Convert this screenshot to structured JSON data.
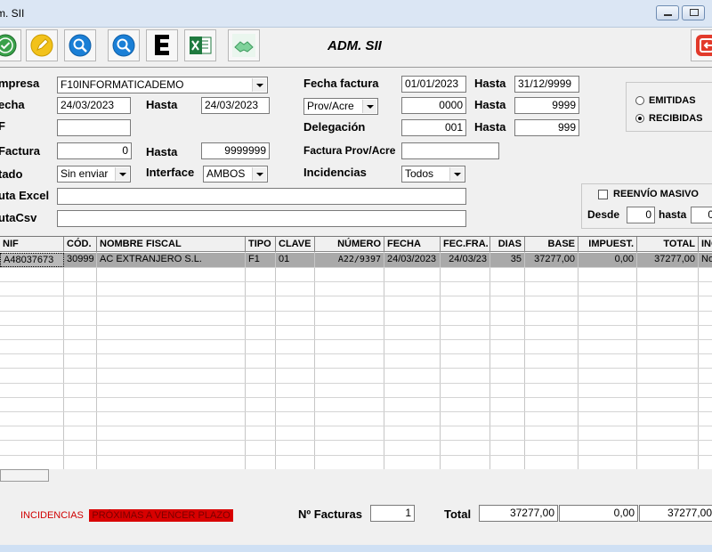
{
  "window": {
    "title": "m. SII"
  },
  "toolbar": {
    "title": "ADM. SII",
    "buttons": [
      {
        "icon": "check-circle-icon",
        "color": "#3aa14a"
      },
      {
        "icon": "pencil-icon",
        "color": "#f2c21b"
      },
      {
        "icon": "search-icon",
        "color": "#1a7fd6"
      },
      {
        "icon": "search-icon",
        "color": "#1a7fd6"
      },
      {
        "icon": "letter-e-icon",
        "color": "#000000"
      },
      {
        "icon": "excel-icon",
        "color": "#1f7a3f"
      },
      {
        "icon": "handshake-icon",
        "color": "#7ed29a"
      },
      {
        "icon": "exit-icon",
        "color": "#e23a2b"
      }
    ]
  },
  "form": {
    "empresa_label": "mpresa",
    "empresa_value": "F10INFORMATICADEMO",
    "fecha_label": "echa",
    "fecha_value": "24/03/2023",
    "fecha_hasta_label": "Hasta",
    "fecha_hasta_value": "24/03/2023",
    "nif_label": "F",
    "nif_value": "",
    "nfactura_label": "Factura",
    "nfactura_value": "0",
    "nfactura_hasta_label": "Hasta",
    "nfactura_hasta_value": "9999999",
    "estado_label": "tado",
    "estado_value": "Sin enviar",
    "interface_label": "Interface",
    "interface_value": "AMBOS",
    "rutaexcel_label": "uta Excel",
    "rutaexcel_value": "",
    "rutacsv_label": "utaCsv",
    "rutacsv_value": "",
    "fechafactura_label": "Fecha factura",
    "fechafactura_value": "01/01/2023",
    "fechafactura_hasta_label": "Hasta",
    "fechafactura_hasta_value": "31/12/9999",
    "prov_select": "Prov/Acre",
    "prov_from": "0000",
    "prov_hasta_label": "Hasta",
    "prov_to": "9999",
    "delegacion_label": "Delegación",
    "delegacion_from": "001",
    "delegacion_hasta_label": "Hasta",
    "delegacion_to": "999",
    "facturaprov_label": "Factura Prov/Acre",
    "facturaprov_value": "",
    "incidencias_label": "Incidencias",
    "incidencias_value": "Todos",
    "emitidas_label": "EMITIDAS",
    "recibidas_label": "RECIBIDAS",
    "selected_mode": "RECIBIDAS",
    "reenvio_label": "REENVÍO MASIVO",
    "desde_label": "Desde",
    "desde_value": "0",
    "hasta_label": "hasta",
    "hasta_value": "0"
  },
  "grid": {
    "columns": [
      "NIF",
      "CÓD.",
      "NOMBRE FISCAL",
      "TIPO",
      "CLAVE",
      "NÚMERO",
      "FECHA",
      "FEC.FRA.",
      "DIAS",
      "BASE",
      "IMPUEST.",
      "TOTAL",
      "INC"
    ],
    "rows": [
      [
        "A48037673",
        "30999",
        "AC EXTRANJERO S.L.",
        "F1",
        "01",
        "A22/9397",
        "24/03/2023",
        "24/03/23",
        "35",
        "37277,00",
        "0,00",
        "37277,00",
        "No"
      ]
    ]
  },
  "footer": {
    "legend_incidencias": "INCIDENCIAS",
    "legend_proximas": "PRÓXIMAS A VENCER PLAZO",
    "nfacturas_label": "Nº Facturas",
    "nfacturas_value": "1",
    "total_label": "Total",
    "total_base": "37277,00",
    "total_impuestos": "0,00",
    "total_total": "37277,00"
  }
}
